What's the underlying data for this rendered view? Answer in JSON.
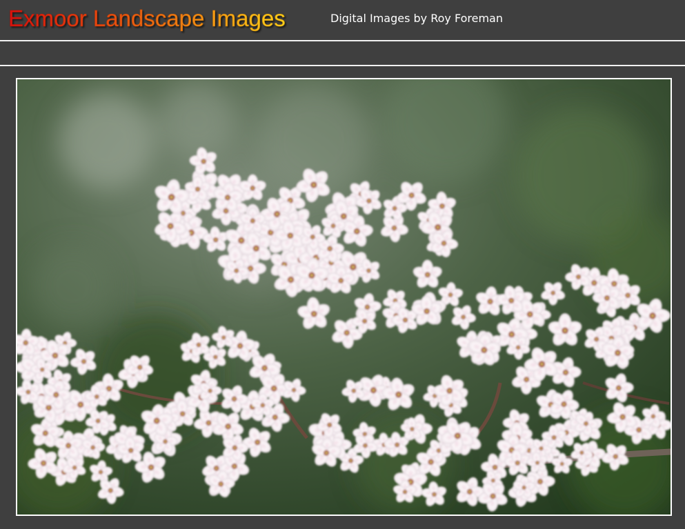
{
  "header": {
    "site_title": "Exmoor Landscape Images",
    "subtitle": "Digital Images by Roy Foreman"
  },
  "photo": {
    "subject": "cherry-blossom-branch",
    "colors": {
      "background_dark": "#2b4424",
      "background_mid": "#5b6f55",
      "petal": "#f7f1f4",
      "petal_shade": "#e2d4dc",
      "stamen": "#a0503a",
      "branch": "#6f6258"
    }
  },
  "theme": {
    "page_background": "#3f3f3f",
    "rule_color": "#f2f2f2",
    "title_gradient_start": "#d8120e",
    "title_gradient_end": "#ffd21a"
  }
}
